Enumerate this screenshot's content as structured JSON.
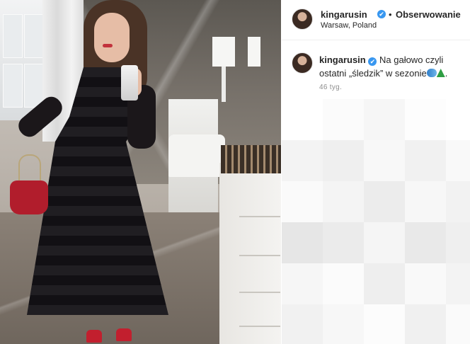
{
  "post": {
    "username": "kingarusin",
    "verified_glyph": "✔",
    "follow_separator": "•",
    "follow_label": "Obserwowanie",
    "location": "Warsaw, Poland",
    "caption_text": "Na gałowo czyli ostatni „śledzik” w sezonie",
    "caption_end": ".",
    "emoji_icons": [
      "fish-emoji",
      "christmas-tree-emoji"
    ],
    "timestamp": "46 tyg."
  },
  "colors": {
    "verified": "#3897f0",
    "text": "#262626",
    "muted": "#8e8e8e"
  }
}
